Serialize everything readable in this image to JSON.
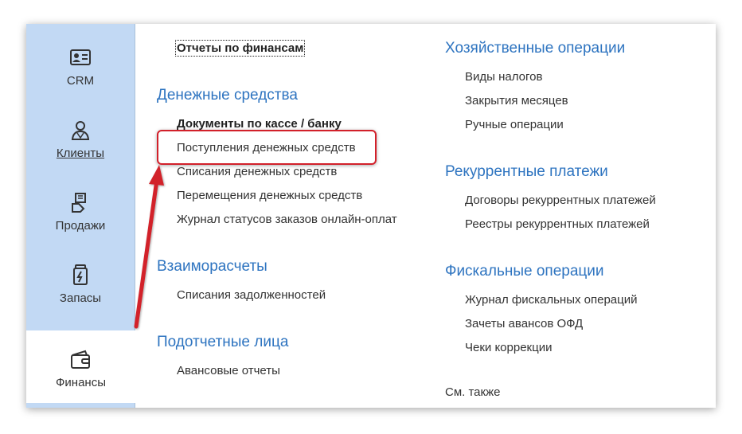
{
  "sidebar": {
    "items": [
      {
        "label": "CRM",
        "icon": "id-card-icon"
      },
      {
        "label": "Клиенты",
        "icon": "person-icon"
      },
      {
        "label": "Продажи",
        "icon": "sales-icon"
      },
      {
        "label": "Запасы",
        "icon": "jar-icon"
      },
      {
        "label": "Финансы",
        "icon": "wallet-icon",
        "active": true
      }
    ]
  },
  "left_column": {
    "top_link": "Отчеты по финансам",
    "sections": [
      {
        "title": "Денежные средства",
        "items": [
          "Документы по кассе / банку",
          "Поступления денежных средств",
          "Списания денежных средств",
          "Перемещения денежных средств",
          "Журнал статусов заказов онлайн-оплат"
        ]
      },
      {
        "title": "Взаиморасчеты",
        "items": [
          "Списания задолженностей"
        ]
      },
      {
        "title": "Подотчетные лица",
        "items": [
          "Авансовые отчеты"
        ]
      }
    ]
  },
  "right_column": {
    "sections": [
      {
        "title": "Хозяйственные операции",
        "items": [
          "Виды налогов",
          "Закрытия месяцев",
          "Ручные операции"
        ]
      },
      {
        "title": "Рекуррентные платежи",
        "items": [
          "Договоры рекуррентных платежей",
          "Реестры рекуррентных платежей"
        ]
      },
      {
        "title": "Фискальные операции",
        "items": [
          "Журнал фискальных операций",
          "Зачеты авансов ОФД",
          "Чеки коррекции"
        ]
      }
    ],
    "see_also": "См. также"
  },
  "colors": {
    "sidebar_bg": "#c2d9f4",
    "heading": "#2e74c0",
    "text": "#333333",
    "annotation": "#d2202a"
  }
}
